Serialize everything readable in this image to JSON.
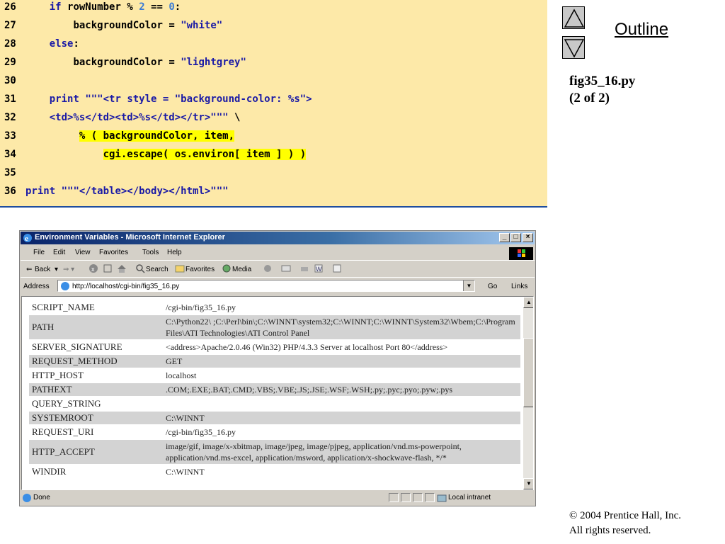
{
  "code": {
    "lines": [
      {
        "num": "26",
        "code": "    if rowNumber % 2 == 0:"
      },
      {
        "num": "27",
        "code": "        backgroundColor = \"white\""
      },
      {
        "num": "28",
        "code": "    else:"
      },
      {
        "num": "29",
        "code": "        backgroundColor = \"lightgrey\""
      },
      {
        "num": "30",
        "code": ""
      },
      {
        "num": "31",
        "code": "    print \"\"\"<tr style = \"background-color: %s\">"
      },
      {
        "num": "32",
        "code": "    <td>%s</td><td>%s</td></tr>\"\"\" \\"
      },
      {
        "num": "33",
        "code": "         % ( backgroundColor, item,"
      },
      {
        "num": "34",
        "code": "             cgi.escape( os.environ[ item ] ) )"
      },
      {
        "num": "35",
        "code": ""
      },
      {
        "num": "36",
        "code": "print \"\"\"</table></body></html>\"\"\""
      }
    ]
  },
  "outline": {
    "up_button": "up-arrow",
    "down_button": "down-arrow",
    "title": "Outline",
    "file_name": "fig35_16.py",
    "page_info": "(2 of 2)"
  },
  "browser": {
    "title": "Environment Variables - Microsoft Internet Explorer",
    "menu": [
      "File",
      "Edit",
      "View",
      "Favorites",
      "Tools",
      "Help"
    ],
    "toolbar": {
      "back": "Back",
      "search": "Search",
      "favorites": "Favorites",
      "media": "Media"
    },
    "address_label": "Address",
    "address_value": "http://localhost/cgi-bin/fig35_16.py",
    "go_label": "Go",
    "links_label": "Links",
    "status": "Done",
    "zone": "Local intranet",
    "env_rows": [
      {
        "key": "SCRIPT_NAME",
        "value": "/cgi-bin/fig35_16.py"
      },
      {
        "key": "PATH",
        "value": "C:\\Python22\\ ;C:\\Perl\\bin\\;C:\\WINNT\\system32;C:\\WINNT;C:\\WINNT\\System32\\Wbem;C:\\Program Files\\ATI Technologies\\ATI Control Panel"
      },
      {
        "key": "SERVER_SIGNATURE",
        "value": "<address>Apache/2.0.46 (Win32) PHP/4.3.3 Server at localhost Port 80</address>"
      },
      {
        "key": "REQUEST_METHOD",
        "value": "GET"
      },
      {
        "key": "HTTP_HOST",
        "value": "localhost"
      },
      {
        "key": "PATHEXT",
        "value": ".COM;.EXE;.BAT;.CMD;.VBS;.VBE;.JS;.JSE;.WSF;.WSH;.py;.pyc;.pyo;.pyw;.pys"
      },
      {
        "key": "QUERY_STRING",
        "value": ""
      },
      {
        "key": "SYSTEMROOT",
        "value": "C:\\WINNT"
      },
      {
        "key": "REQUEST_URI",
        "value": "/cgi-bin/fig35_16.py"
      },
      {
        "key": "HTTP_ACCEPT",
        "value": "image/gif, image/x-xbitmap, image/jpeg, image/pjpeg, application/vnd.ms-powerpoint, application/vnd.ms-excel, application/msword, application/x-shockwave-flash, */*"
      },
      {
        "key": "WINDIR",
        "value": "C:\\WINNT"
      }
    ]
  },
  "footer": {
    "copyright": "© 2004 Prentice Hall, Inc.",
    "rights": "All rights reserved."
  }
}
